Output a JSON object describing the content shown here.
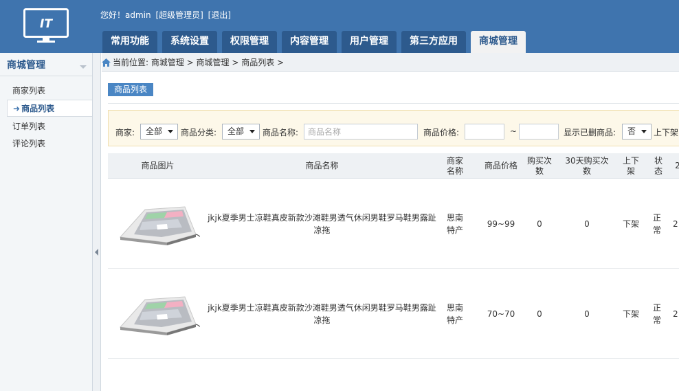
{
  "logo": {
    "text": "IT"
  },
  "greeting": {
    "hello": "您好！admin",
    "role": "[超级管理员]",
    "logout": "[退出]"
  },
  "tabs": [
    {
      "label": "常用功能",
      "active": false
    },
    {
      "label": "系统设置",
      "active": false
    },
    {
      "label": "权限管理",
      "active": false
    },
    {
      "label": "内容管理",
      "active": false
    },
    {
      "label": "用户管理",
      "active": false
    },
    {
      "label": "第三方应用",
      "active": false
    },
    {
      "label": "商城管理",
      "active": true
    }
  ],
  "sidebar": {
    "title": "商城管理",
    "items": [
      {
        "label": "商家列表",
        "active": false
      },
      {
        "label": "商品列表",
        "active": true
      },
      {
        "label": "订单列表",
        "active": false
      },
      {
        "label": "评论列表",
        "active": false
      }
    ]
  },
  "breadcrumb": "当前位置: 商城管理 > 商城管理 > 商品列表 >",
  "page_tag": "商品列表",
  "filter": {
    "merchant_label": "商家:",
    "merchant_value": "全部",
    "category_label": "商品分类:",
    "category_value": "全部",
    "name_label": "商品名称:",
    "name_placeholder": "商品名称",
    "price_label": "商品价格:",
    "price_sep": "~",
    "deleted_label": "显示已删商品:",
    "deleted_value": "否",
    "status_label": "上下架"
  },
  "table": {
    "headers": [
      "商品图片",
      "商品名称",
      "商家名称",
      "商品价格",
      "购买次数",
      "30天购买次数",
      "上下架",
      "状态",
      "2"
    ],
    "rows": [
      {
        "image": "keyboard-image",
        "name": "jkjk夏季男士凉鞋真皮新款沙滩鞋男透气休闲男鞋罗马鞋男露趾凉拖",
        "merchant": "思南特产",
        "price": "99~99",
        "buys": "0",
        "buys30": "0",
        "shelf": "下架",
        "status": "正常",
        "extra": "2"
      },
      {
        "image": "keyboard-image",
        "name": "jkjk夏季男士凉鞋真皮新款沙滩鞋男透气休闲男鞋罗马鞋男露趾凉拖",
        "merchant": "思南特产",
        "price": "70~70",
        "buys": "0",
        "buys30": "0",
        "shelf": "下架",
        "status": "正常",
        "extra": "2"
      }
    ]
  },
  "colors": {
    "header": "#3f74ae",
    "tab": "#2d5a8d",
    "filter_bg": "#fdf8e9",
    "tag": "#4a86c4"
  }
}
